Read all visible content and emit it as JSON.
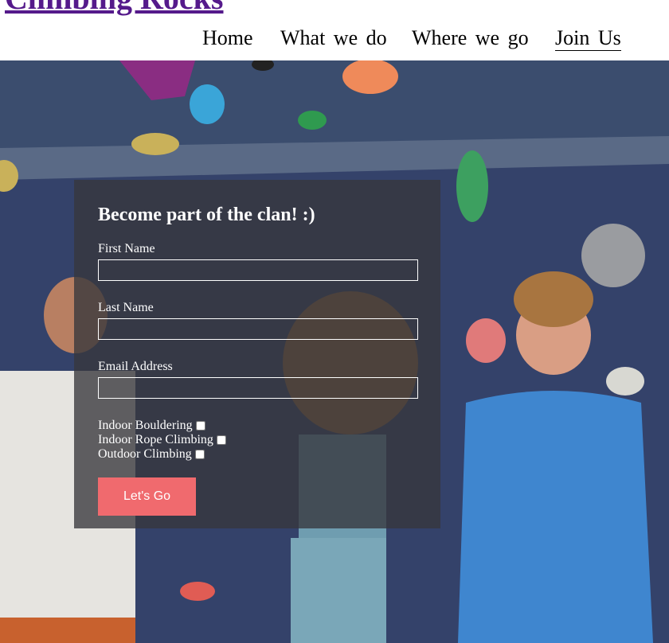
{
  "site": {
    "title": "Climbing Rocks"
  },
  "nav": {
    "items": [
      {
        "label": "Home"
      },
      {
        "label": "What we do"
      },
      {
        "label": "Where we go"
      },
      {
        "label": "Join Us"
      }
    ]
  },
  "form": {
    "heading": "Become part of the clan! :)",
    "first_name_label": "First Name",
    "first_name_value": "",
    "last_name_label": "Last Name",
    "last_name_value": "",
    "email_label": "Email Address",
    "email_value": "",
    "checkboxes": [
      {
        "label": "Indoor Bouldering",
        "checked": false
      },
      {
        "label": "Indoor Rope Climbing",
        "checked": false
      },
      {
        "label": "Outdoor Climbing",
        "checked": false
      }
    ],
    "submit_label": "Let's Go"
  },
  "colors": {
    "title_link": "#551a8b",
    "button": "#f06a6e",
    "wall": "#38476a"
  }
}
